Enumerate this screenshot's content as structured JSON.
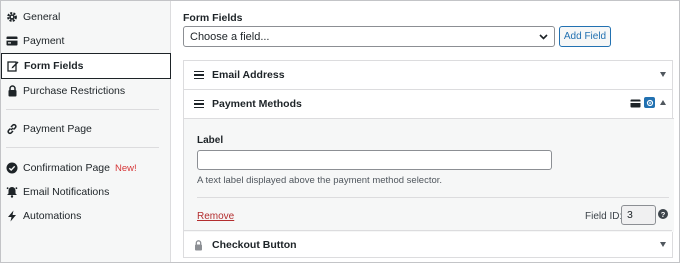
{
  "sidebar": {
    "items": [
      {
        "label": "General",
        "icon": "gear-icon"
      },
      {
        "label": "Payment",
        "icon": "credit-card-icon"
      },
      {
        "label": "Form Fields",
        "icon": "edit-icon",
        "active": true
      },
      {
        "label": "Purchase Restrictions",
        "icon": "lock-icon"
      },
      {
        "label": "Payment Page",
        "icon": "link-icon"
      },
      {
        "label": "Confirmation Page",
        "icon": "check-circle-icon",
        "badge": "New!"
      },
      {
        "label": "Email Notifications",
        "icon": "bell-icon"
      },
      {
        "label": "Automations",
        "icon": "bolt-icon"
      }
    ]
  },
  "main": {
    "section_title": "Form Fields",
    "select_value": "Choose a field...",
    "add_button": "Add Field",
    "fields": [
      {
        "title": "Email Address"
      },
      {
        "title": "Payment Methods"
      },
      {
        "title": "Checkout Button"
      }
    ],
    "settings": {
      "label": "Label",
      "input_value": "",
      "help_text": "A text label displayed above the payment method selector.",
      "remove": "Remove",
      "field_id_label": "Field ID:",
      "field_id": "3",
      "help_icon": "?"
    }
  },
  "colors": {
    "accent": "#2271b1",
    "danger": "#b32d2e",
    "new_badge": "#d63638"
  }
}
